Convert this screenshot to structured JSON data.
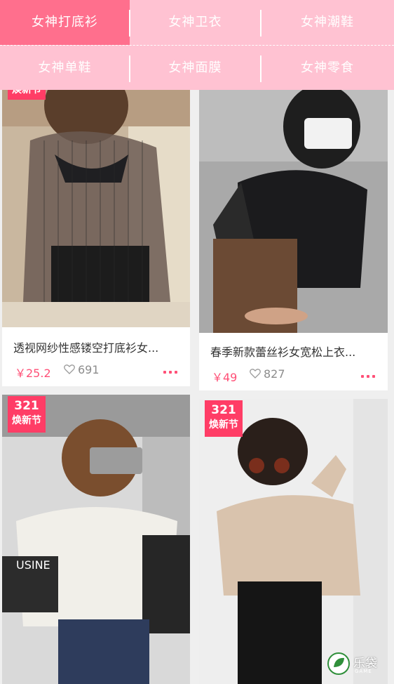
{
  "nav": {
    "categories": [
      {
        "label": "女神打底衫",
        "active": true
      },
      {
        "label": "女神卫衣",
        "active": false
      },
      {
        "label": "女神潮鞋",
        "active": false
      },
      {
        "label": "女神单鞋",
        "active": false
      },
      {
        "label": "女神面膜",
        "active": false
      },
      {
        "label": "女神零食",
        "active": false
      }
    ]
  },
  "products": [
    {
      "title": "透视网纱性感镂空打底衫女...",
      "price": "￥25.2",
      "likes": "691",
      "badge_num": "",
      "badge_text": "焕新节"
    },
    {
      "title": "春季新款蕾丝衫女宽松上衣...",
      "price": "￥49",
      "likes": "827",
      "badge_num": "",
      "badge_text": ""
    },
    {
      "title": "",
      "price": "",
      "likes": "",
      "badge_num": "321",
      "badge_text": "焕新节"
    },
    {
      "title": "",
      "price": "",
      "likes": "",
      "badge_num": "321",
      "badge_text": "焕新节"
    }
  ],
  "watermark": {
    "text": "乐袋",
    "sub": "GAME"
  },
  "colors": {
    "nav_bg": "#ffc2d2",
    "nav_active": "#ff6f8d",
    "price": "#ff5077",
    "badge": "#ff3d66"
  }
}
